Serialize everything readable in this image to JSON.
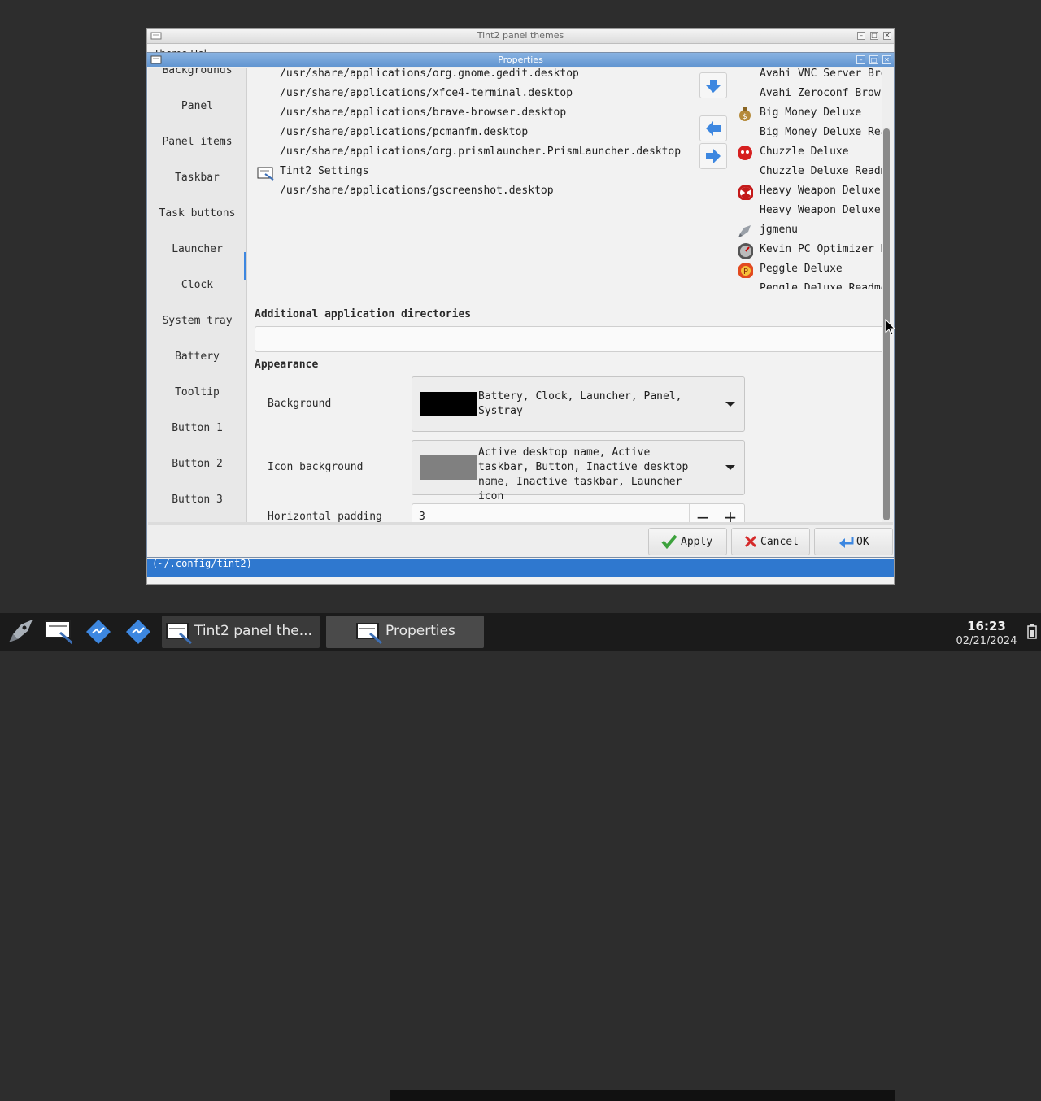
{
  "themes_window": {
    "title": "Tint2 panel themes",
    "menu_partial": "Theme Hel",
    "config_path": "(~/.config/tint2)"
  },
  "properties": {
    "title": "Properties",
    "sidebar": [
      {
        "label": "Backgrounds"
      },
      {
        "label": "Panel"
      },
      {
        "label": "Panel items"
      },
      {
        "label": "Taskbar"
      },
      {
        "label": "Task buttons"
      },
      {
        "label": "Launcher"
      },
      {
        "label": "Clock"
      },
      {
        "label": "System tray"
      },
      {
        "label": "Battery"
      },
      {
        "label": "Tooltip"
      },
      {
        "label": "Button 1"
      },
      {
        "label": "Button 2"
      },
      {
        "label": "Button 3"
      }
    ],
    "selected_sidebar": "Launcher",
    "launcher_items": [
      "/usr/share/applications/org.gnome.gedit.desktop",
      "/usr/share/applications/xfce4-terminal.desktop",
      "/usr/share/applications/brave-browser.desktop",
      "/usr/share/applications/pcmanfm.desktop",
      "/usr/share/applications/org.prismlauncher.PrismLauncher.desktop",
      "Tint2 Settings",
      "/usr/share/applications/gscreenshot.desktop"
    ],
    "available_apps": [
      {
        "label": "Avahi VNC Server Browser",
        "icon": "none"
      },
      {
        "label": "Avahi Zeroconf Browser",
        "icon": "none"
      },
      {
        "label": "Big Money Deluxe",
        "icon": "money-bag-icon"
      },
      {
        "label": "Big Money Deluxe Readme",
        "icon": "none"
      },
      {
        "label": "Chuzzle Deluxe",
        "icon": "chuzzle-icon"
      },
      {
        "label": "Chuzzle Deluxe Readme",
        "icon": "none"
      },
      {
        "label": "Heavy Weapon Deluxe",
        "icon": "radiation-icon"
      },
      {
        "label": "Heavy Weapon Deluxe Readme",
        "icon": "none"
      },
      {
        "label": "jgmenu",
        "icon": "rocket-icon"
      },
      {
        "label": "Kevin PC Optimizer Home",
        "icon": "gauge-icon"
      },
      {
        "label": "Peggle Deluxe",
        "icon": "peggle-icon"
      },
      {
        "label": "Peggle Deluxe Readme",
        "icon": "none"
      }
    ],
    "additional_dirs": {
      "heading": "Additional application directories",
      "value": ""
    },
    "appearance": {
      "heading": "Appearance",
      "background_label": "Background",
      "background_value": "Battery, Clock, Launcher, Panel, Systray",
      "background_color": "#000000",
      "icon_background_label": "Icon background",
      "icon_background_value": "Active desktop name, Active taskbar, Button, Inactive desktop name, Inactive taskbar, Launcher icon",
      "icon_background_color": "#808080",
      "horizontal_padding_label": "Horizontal padding",
      "horizontal_padding_value": "3"
    },
    "buttons": {
      "apply": "Apply",
      "cancel": "Cancel",
      "ok": "OK"
    }
  },
  "taskbar": {
    "tasks": [
      {
        "label": "Tint2 panel the..."
      },
      {
        "label": "Properties"
      }
    ],
    "clock_time": "16:23",
    "clock_date": "02/21/2024"
  },
  "colors": {
    "accent": "#3d87e0",
    "titlebar_active": "#6f9fd8",
    "taskbar_bg": "#1b1b1b"
  }
}
